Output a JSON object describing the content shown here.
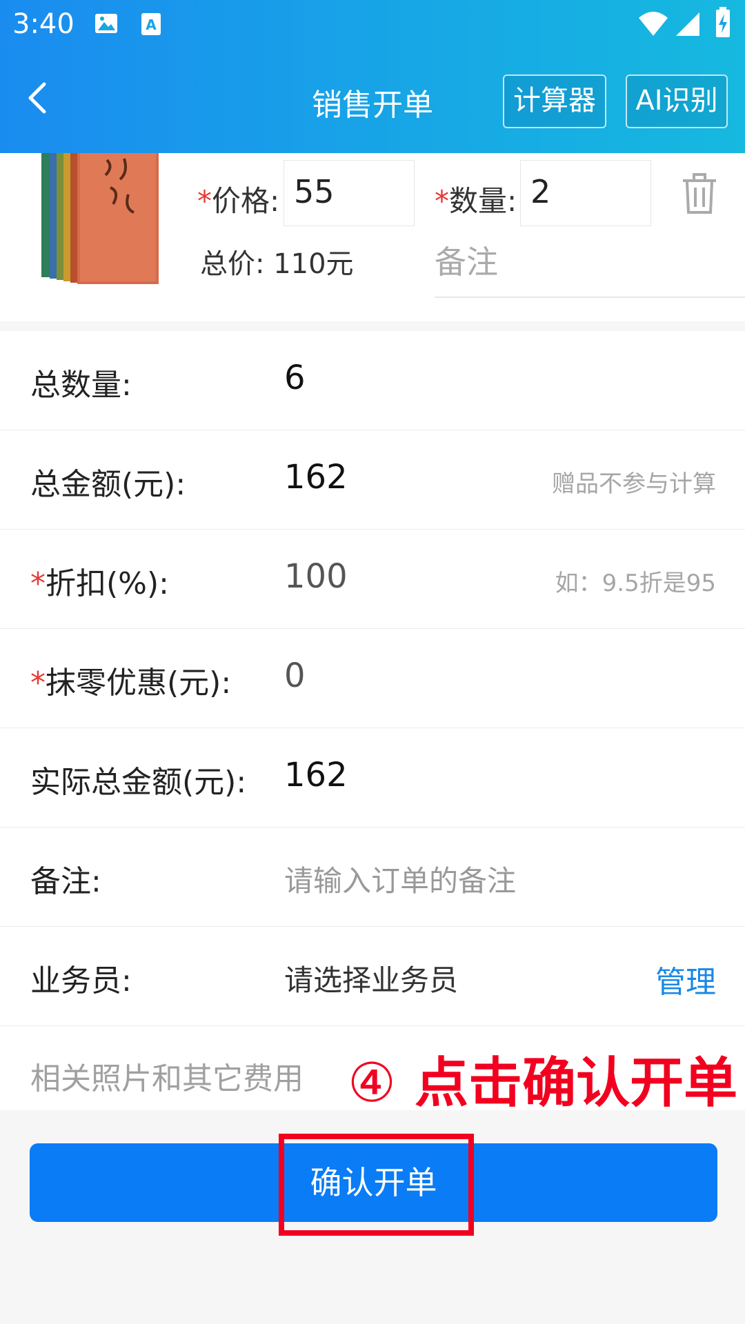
{
  "status_bar": {
    "time": "3:40"
  },
  "header": {
    "title": "销售开单",
    "calculator_label": "计算器",
    "ai_label": "AI识别"
  },
  "product": {
    "price_label": "价格:",
    "price_value": "55",
    "qty_label": "数量:",
    "qty_value": "2",
    "subtotal_text": "总价: 110元",
    "remark_placeholder": "备注"
  },
  "summary": {
    "total_qty_label": "总数量:",
    "total_qty_value": "6",
    "total_amount_label": "总金额(元):",
    "total_amount_value": "162",
    "total_amount_hint": "赠品不参与计算",
    "discount_label": "折扣(%):",
    "discount_value": "100",
    "discount_hint": "如：9.5折是95",
    "rounding_label": "抹零优惠(元):",
    "rounding_value": "0",
    "actual_label": "实际总金额(元):",
    "actual_value": "162",
    "note_label": "备注:",
    "note_placeholder": "请输入订单的备注",
    "salesperson_label": "业务员:",
    "salesperson_placeholder": "请选择业务员",
    "manage_link": "管理",
    "photos_label": "相关照片和其它费用"
  },
  "annotation": {
    "circle": "④",
    "text": "点击确认开单"
  },
  "confirm_button": "确认开单",
  "colors": {
    "accent": "#0a7cf5",
    "required": "#e53935",
    "annotation": "#f2001f"
  }
}
